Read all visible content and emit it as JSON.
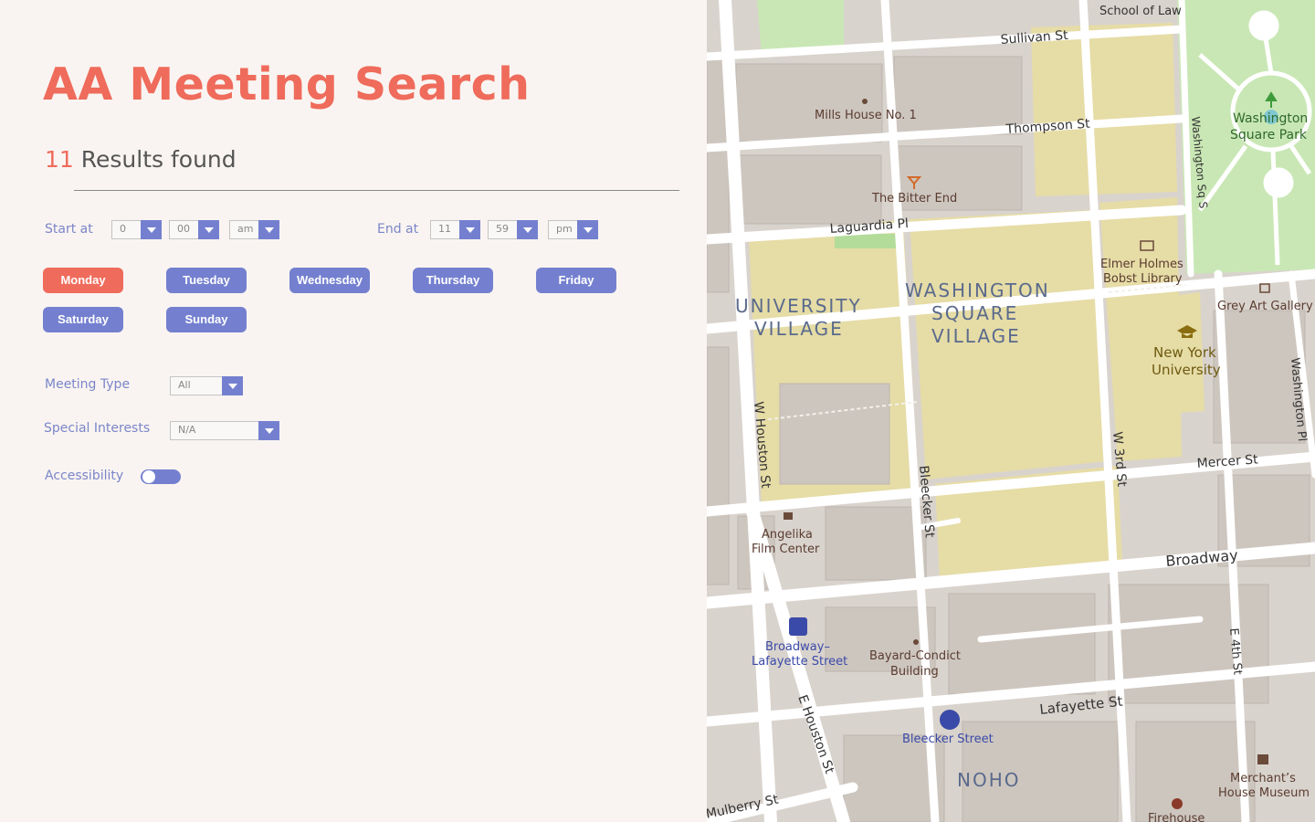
{
  "title": "AA Meeting Search",
  "results": {
    "count": "11",
    "label": "Results found"
  },
  "start": {
    "label": "Start at",
    "hour": "0",
    "minute": "00",
    "ampm": "am"
  },
  "end": {
    "label": "End at",
    "hour": "11",
    "minute": "59",
    "ampm": "pm"
  },
  "days": [
    {
      "label": "Monday",
      "selected": true
    },
    {
      "label": "Tuesday",
      "selected": false
    },
    {
      "label": "Wednesday",
      "selected": false
    },
    {
      "label": "Thursday",
      "selected": false
    },
    {
      "label": "Friday",
      "selected": false
    },
    {
      "label": "Saturday",
      "selected": false
    },
    {
      "label": "Sunday",
      "selected": false
    }
  ],
  "meeting_type": {
    "label": "Meeting Type",
    "value": "All"
  },
  "special_interests": {
    "label": "Special Interests",
    "value": "N/A"
  },
  "accessibility": {
    "label": "Accessibility",
    "enabled": false
  },
  "colors": {
    "accent": "#ef6b5b",
    "primary": "#7480cf",
    "background": "#f9f4f1"
  },
  "map": {
    "streets": {
      "sullivan": "Sullivan St",
      "thompson": "Thompson St",
      "laguardia": "Laguardia Pl",
      "w_houston": "W Houston St",
      "bleecker": "Bleecker St",
      "w_3rd": "W 3rd St",
      "mercer": "Mercer St",
      "broadway": "Broadway",
      "lafayette": "Lafayette St",
      "e_houston": "E Houston St",
      "mulberry": "Mulberry St",
      "washington_sq": "Washington Sq S",
      "washington_pl": "Washington Pl",
      "e_4th": "E 4th St",
      "school_of_law": "School of Law"
    },
    "areas": {
      "university_village_1": "UNIVERSITY",
      "university_village_2": "VILLAGE",
      "wsv_1": "WASHINGTON",
      "wsv_2": "SQUARE",
      "wsv_3": "VILLAGE",
      "noho": "NOHO"
    },
    "pois": {
      "mills_house": "Mills House No. 1",
      "bitter_end": "The Bitter End",
      "bobst_1": "Elmer Holmes",
      "bobst_2": "Bobst Library",
      "grey_art": "Grey Art Gallery",
      "nyu_1": "New York",
      "nyu_2": "University",
      "wsp_1": "Washington",
      "wsp_2": "Square Park",
      "angelika_1": "Angelika",
      "angelika_2": "Film Center",
      "bway_laf_1": "Broadway–",
      "bway_laf_2": "Lafayette Street",
      "bayard_1": "Bayard-Condict",
      "bayard_2": "Building",
      "bleecker_station": "Bleecker Street",
      "merchants_1": "Merchant’s",
      "merchants_2": "House Museum",
      "firehouse": "Firehouse"
    }
  }
}
